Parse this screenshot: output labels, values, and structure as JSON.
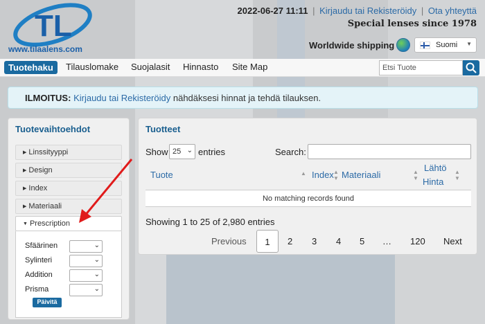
{
  "header": {
    "logo_letters": "TL",
    "logo_url": "www.tilaalens.com",
    "datetime": "2022-06-27 11:11",
    "login_link": "Kirjaudu tai Rekisteröidy",
    "separator": "|",
    "contact_link": "Ota yhteyttä",
    "tagline": "Special lenses since 1978",
    "shipping": "Worldwide shipping",
    "language": "Suomi"
  },
  "nav": {
    "items": [
      "Tuotehaku",
      "Tilauslomake",
      "Suojalasit",
      "Hinnasto",
      "Site Map"
    ],
    "search_placeholder": "Etsi Tuote"
  },
  "notice": {
    "label": "ILMOITUS:",
    "link": "Kirjaudu tai Rekisteröidy",
    "text": " nähdäksesi hinnat ja tehdä tilauksen."
  },
  "filters": {
    "title": "Tuotevaihtoehdot",
    "sections": [
      "Linssityyppi",
      "Design",
      "Index",
      "Materiaali",
      "Prescription"
    ],
    "fields": [
      "Sfäärinen",
      "Sylinteri",
      "Addition",
      "Prisma"
    ],
    "update_button": "Päivitä"
  },
  "products": {
    "title": "Tuotteet",
    "show_label": "Show",
    "page_length": "25",
    "entries_label": "entries",
    "search_label": "Search:",
    "columns": [
      "Tuote",
      "Index",
      "Materiaali",
      "Lähtö",
      "Hinta"
    ],
    "empty_message": "No matching records found",
    "info": "Showing 1 to 25 of 2,980 entries",
    "pagination": {
      "previous": "Previous",
      "pages": [
        "1",
        "2",
        "3",
        "4",
        "5",
        "…",
        "120"
      ],
      "next": "Next"
    }
  },
  "colors": {
    "accent": "#1a6aa0",
    "link": "#2b6aa6",
    "annotation_arrow": "#e01b1b"
  }
}
